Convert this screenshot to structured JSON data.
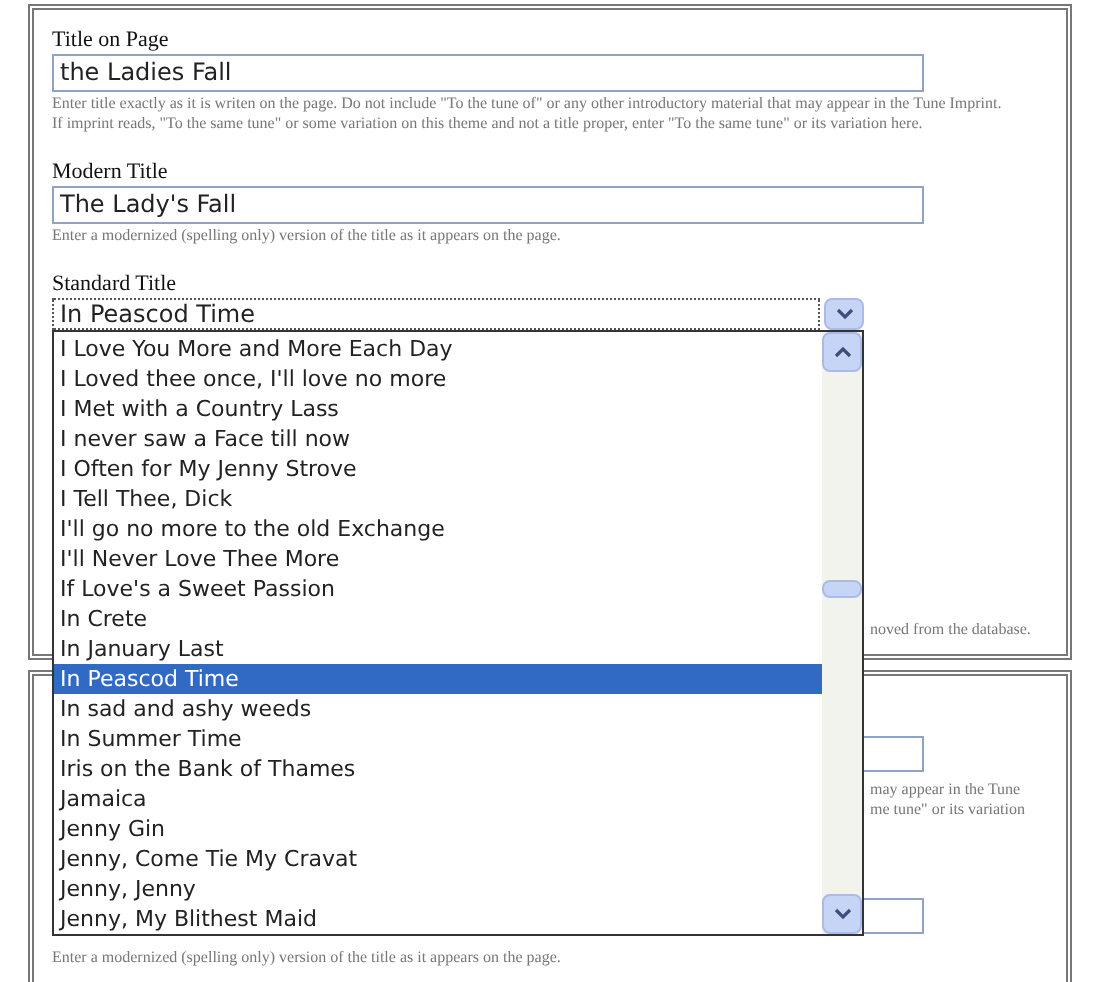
{
  "panels": [
    {
      "fields": [
        {
          "kind": "text",
          "label": "Title on Page",
          "value": "the Ladies Fall",
          "hint": "Enter title exactly as it is writen on the page. Do not include \"To the tune of\" or any other introductory material that may appear in the Tune Imprint. If imprint reads, \"To the same tune\" or some variation on this theme and not a title proper, enter \"To the same tune\" or its variation here."
        },
        {
          "kind": "text",
          "label": "Modern Title",
          "value": "The Lady's Fall",
          "hint": "Enter a modernized (spelling only) version of the title as it appears on the page."
        },
        {
          "kind": "select",
          "label": "Standard Title",
          "value": "In Peascod Time",
          "expanded": true,
          "options": [
            {
              "label": "I Love You More and More Each Day",
              "selected": false
            },
            {
              "label": "I Loved thee once, I'll love no more",
              "selected": false
            },
            {
              "label": "I Met with a Country Lass",
              "selected": false
            },
            {
              "label": "I never saw a Face till now",
              "selected": false
            },
            {
              "label": "I Often for My Jenny Strove",
              "selected": false
            },
            {
              "label": "I Tell Thee, Dick",
              "selected": false
            },
            {
              "label": "I'll go no more to the old Exchange",
              "selected": false
            },
            {
              "label": "I'll Never Love Thee More",
              "selected": false
            },
            {
              "label": "If Love's a Sweet Passion",
              "selected": false
            },
            {
              "label": "In Crete",
              "selected": false
            },
            {
              "label": "In January Last",
              "selected": false
            },
            {
              "label": "In Peascod Time",
              "selected": true
            },
            {
              "label": "In sad and ashy weeds",
              "selected": false
            },
            {
              "label": "In Summer Time",
              "selected": false
            },
            {
              "label": "Iris on the Bank of Thames",
              "selected": false
            },
            {
              "label": "Jamaica",
              "selected": false
            },
            {
              "label": "Jenny Gin",
              "selected": false
            },
            {
              "label": "Jenny, Come Tie My Cravat",
              "selected": false
            },
            {
              "label": "Jenny, Jenny",
              "selected": false
            },
            {
              "label": "Jenny, My Blithest Maid",
              "selected": false
            }
          ]
        }
      ],
      "partial_hint": "noved from the database."
    },
    {
      "partial_hint_lines": [
        "may appear in the Tune",
        "me tune\" or its variation"
      ],
      "hint": "Enter a modernized (spelling only) version of the title as it appears on the page."
    }
  ]
}
